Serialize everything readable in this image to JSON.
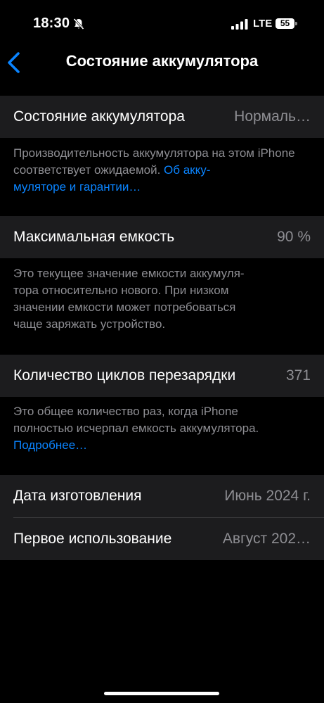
{
  "status_bar": {
    "time": "18:30",
    "network": "LTE",
    "battery_level": "55"
  },
  "nav": {
    "title": "Состояние аккумулятора",
    "back_icon": "chevron-left-icon"
  },
  "health": {
    "label": "Состояние аккумулятора",
    "value": "Нормаль…",
    "footer_text": "Производительность аккумулятора на этом iPhone соответствует ожидаемой. ",
    "footer_link_1": "Об акку-",
    "footer_link_2": "муляторе и гарантии…"
  },
  "capacity": {
    "label": "Максимальная емкость",
    "value": "90 %",
    "footer": [
      "Это текущее значение емкости аккумуля-",
      "тора относительно нового. При низком",
      "значении емкости может потребоваться",
      "чаще заряжать устройство."
    ]
  },
  "cycles": {
    "label": "Количество циклов перезарядки",
    "value": "371",
    "footer": [
      "Это общее количество раз, когда iPhone",
      "полностью исчерпал емкость аккумулятора."
    ],
    "footer_link": "Подробнее…"
  },
  "info": {
    "manufacture_label": "Дата изготовления",
    "manufacture_value": "Июнь 2024 г.",
    "first_use_label": "Первое использование",
    "first_use_value": "Август 202…"
  },
  "colors": {
    "link": "#0a84ff",
    "secondary": "#8e8e93",
    "cell": "#1c1c1e"
  }
}
